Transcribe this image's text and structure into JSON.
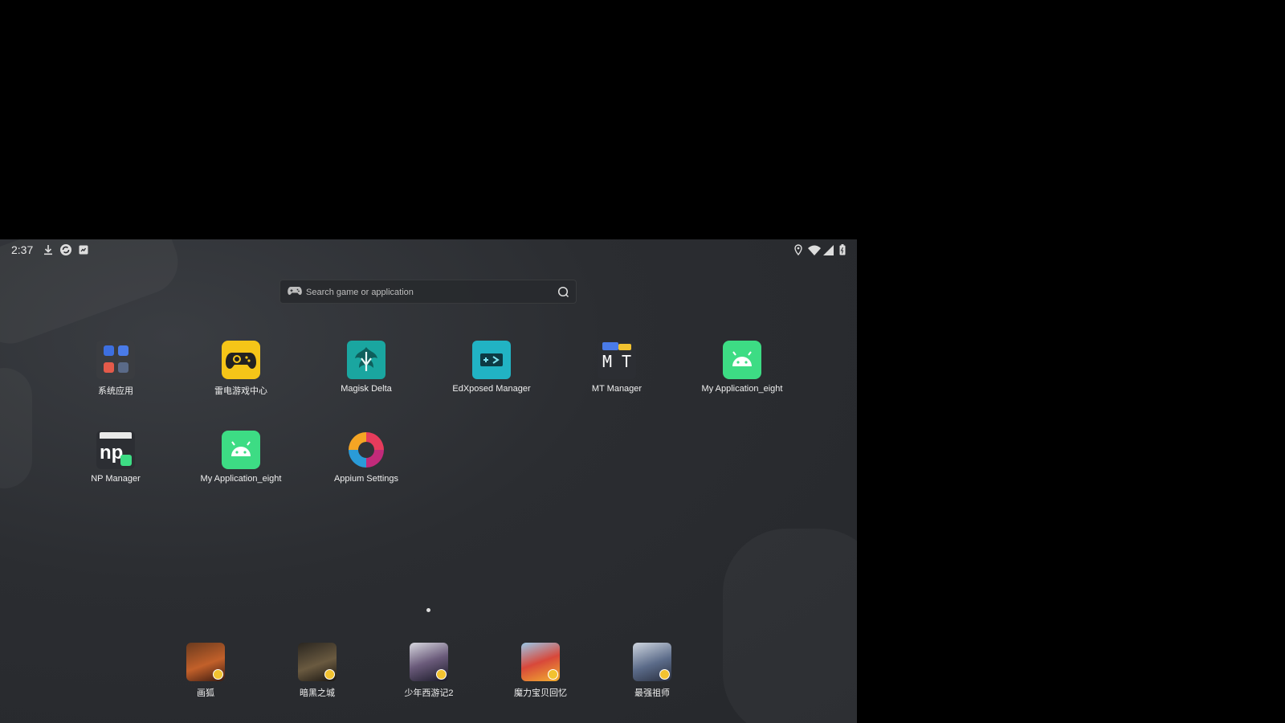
{
  "status_bar": {
    "time": "2:37"
  },
  "search": {
    "placeholder": "Search game or application"
  },
  "apps": [
    {
      "label": "系统应用"
    },
    {
      "label": "雷电游戏中心"
    },
    {
      "label": "Magisk Delta"
    },
    {
      "label": "EdXposed Manager"
    },
    {
      "label": "MT Manager"
    },
    {
      "label": "My Application_eight"
    },
    {
      "label": "NP Manager"
    },
    {
      "label": "My Application_eight"
    },
    {
      "label": "Appium Settings"
    }
  ],
  "dock": [
    {
      "label": "画狐"
    },
    {
      "label": "暗黑之城"
    },
    {
      "label": "少年西游记2"
    },
    {
      "label": "魔力宝贝回忆"
    },
    {
      "label": "最强祖师"
    }
  ],
  "colors": {
    "accent_yellow": "#f5c518",
    "android_green": "#3ddc84",
    "teal": "#1aa6a0"
  },
  "icons": {
    "status": [
      "download-icon",
      "sync-icon",
      "notification-icon",
      "location-icon",
      "wifi-icon",
      "signal-icon",
      "battery-icon"
    ],
    "search": [
      "gamepad-icon",
      "search-icon"
    ]
  }
}
